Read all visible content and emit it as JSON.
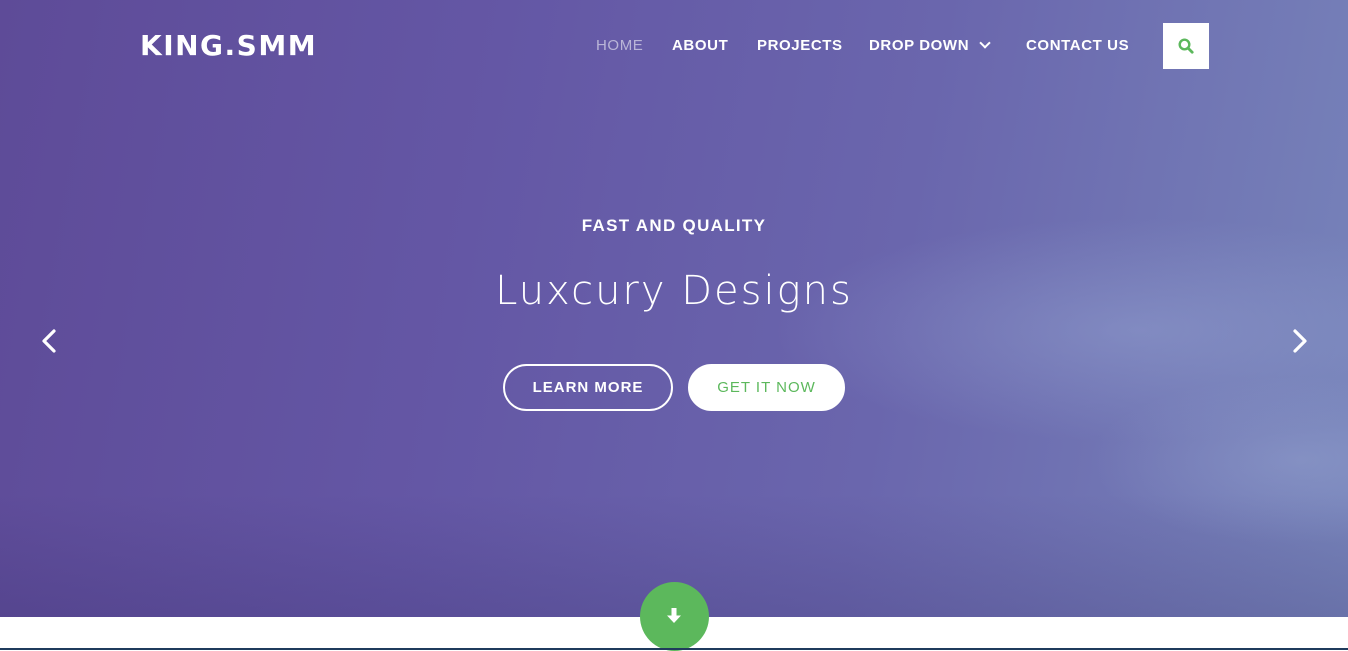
{
  "brand": {
    "name": "KING.SMM"
  },
  "nav": {
    "items": [
      {
        "label": "HOME",
        "active": true
      },
      {
        "label": "ABOUT",
        "active": false
      },
      {
        "label": "PROJECTS",
        "active": false
      },
      {
        "label": "DROP DOWN",
        "active": false,
        "has_dropdown": true,
        "icon": "chevron-down-icon"
      },
      {
        "label": "CONTACT US",
        "active": false
      }
    ],
    "search_icon": "search-icon"
  },
  "hero": {
    "kicker": "FAST AND QUALITY",
    "headline": "Luxcury Designs",
    "primary_button": "LEARN MORE",
    "secondary_button": "GET IT NOW",
    "prev_icon": "chevron-left-icon",
    "next_icon": "chevron-right-icon",
    "scroll_icon": "arrow-down-icon"
  },
  "colors": {
    "hero_gradient_start": "#5e4b98",
    "hero_gradient_end": "#7784ba",
    "accent_green": "#5cb85c",
    "text_white": "#ffffff"
  }
}
